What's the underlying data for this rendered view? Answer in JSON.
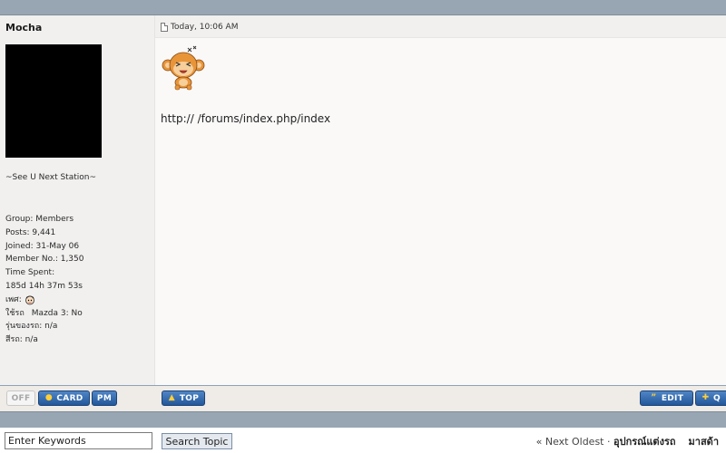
{
  "post": {
    "author": "Mocha",
    "date": "Today, 10:06 AM",
    "body_text": "http://  /forums/index.php/index",
    "signature_title": "~See U Next Station~",
    "info_rows": [
      "Group: Members",
      "Posts: 9,441",
      "Joined: 31-May 06",
      "Member No.: 1,350",
      "Time Spent:",
      "185d 14h 37m 53s"
    ],
    "sex_label": "เพศ:",
    "car_label": "ใช้รถ",
    "car_value": "Mazda 3: No",
    "generation_row": "รุ่นของรถ: n/a",
    "color_row": "สีรถ: n/a"
  },
  "buttons": {
    "off": "OFF",
    "card": "CARD",
    "pm": "PM",
    "top": "TOP",
    "edit": "EDIT",
    "quote": "Q"
  },
  "footer": {
    "search_placeholder": "Enter Keywords",
    "search_button": "Search Topic",
    "nav_prefix": "« Next Oldest ·",
    "nav_link1": "อุปกรณ์แต่งรถ",
    "nav_link2": "มาสด้า"
  },
  "colors": {
    "bar": "#98a6b3",
    "button_blue": "#23579a",
    "panel": "#f1f0ef"
  }
}
